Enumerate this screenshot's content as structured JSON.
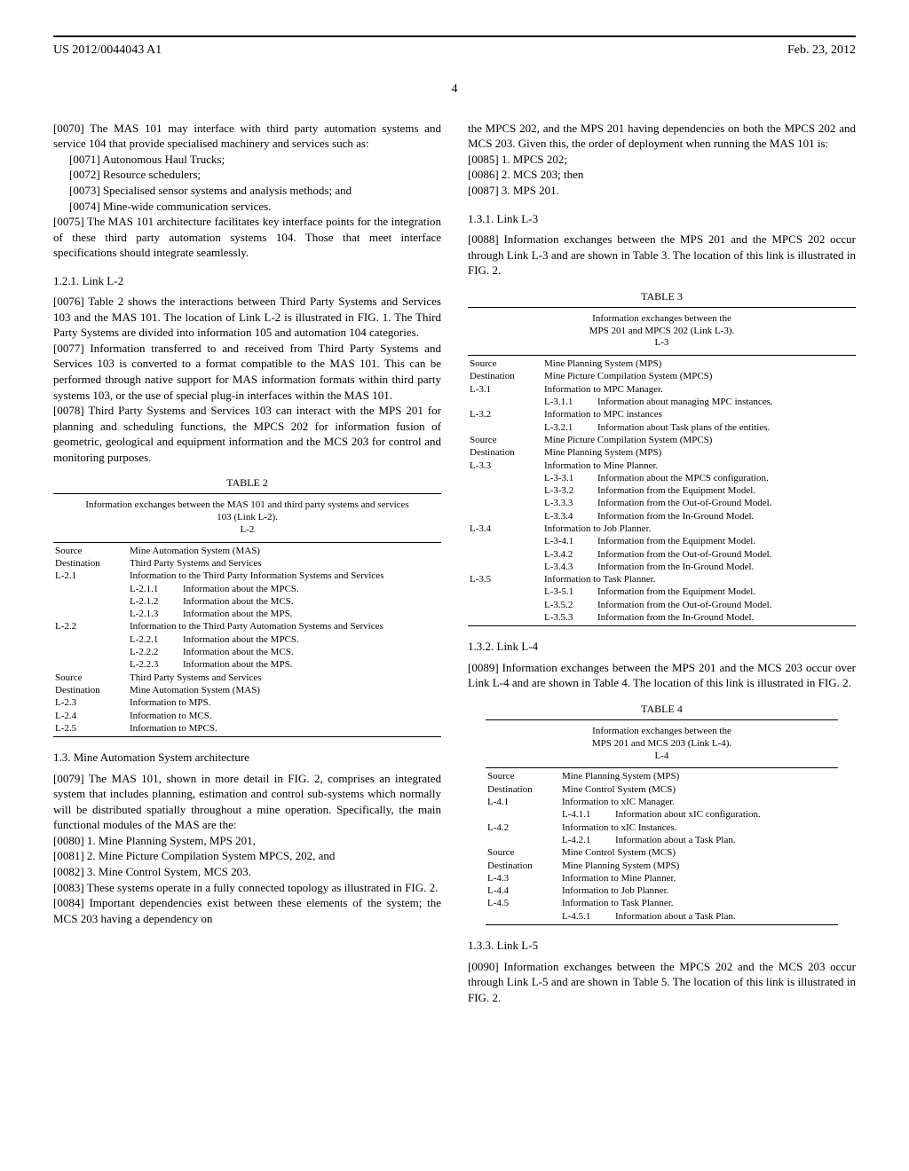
{
  "header": {
    "left": "US 2012/0044043 A1",
    "right": "Feb. 23, 2012",
    "page": "4"
  },
  "col1": {
    "p70": "[0070]   The MAS 101 may interface with third party automation systems and service 104 that provide specialised machinery and services such as:",
    "p71": "[0071]   Autonomous Haul Trucks;",
    "p72": "[0072]   Resource schedulers;",
    "p73": "[0073]   Specialised sensor systems and analysis methods; and",
    "p74": "[0074]   Mine-wide communication services.",
    "p75": "[0075]   The MAS 101 architecture facilitates key interface points for the integration of these third party automation systems 104. Those that meet interface specifications should integrate seamlessly.",
    "h121": "1.2.1. Link L-2",
    "p76": "[0076]   Table 2 shows the interactions between Third Party Systems and Services 103 and the MAS 101. The location of Link L-2 is illustrated in FIG. 1. The Third Party Systems are divided into information 105 and automation 104 categories.",
    "p77": "[0077]   Information transferred to and received from Third Party Systems and Services 103 is converted to a format compatible to the MAS 101. This can be performed through native support for MAS information formats within third party systems 103, or the use of special plug-in interfaces within the MAS 101.",
    "p78": "[0078]   Third Party Systems and Services 103 can interact with the MPS 201 for planning and scheduling functions, the MPCS 202 for information fusion of geometric, geological and equipment information and the MCS 203 for control and monitoring purposes.",
    "table2": {
      "label": "TABLE 2",
      "caption": "Information exchanges between the MAS 101 and third party systems and services 103 (Link L-2).\nL-2",
      "rows": [
        {
          "k": "Source",
          "v": "Mine Automation System (MAS)"
        },
        {
          "k": "Destination",
          "v": "Third Party Systems and Services"
        },
        {
          "k": "L-2.1",
          "v": "Information to the Third Party Information Systems and Services"
        },
        {
          "sub": "L-2.1.1",
          "v": "Information about the MPCS."
        },
        {
          "sub": "L-2.1.2",
          "v": "Information about the MCS."
        },
        {
          "sub": "L-2.1.3",
          "v": "Information about the MPS."
        },
        {
          "k": "L-2.2",
          "v": "Information to the Third Party Automation Systems and Services"
        },
        {
          "sub": "L-2.2.1",
          "v": "Information about the MPCS."
        },
        {
          "sub": "L-2.2.2",
          "v": "Information about the MCS."
        },
        {
          "sub": "L-2.2.3",
          "v": "Information about the MPS."
        },
        {
          "k": "Source",
          "v": "Third Party Systems and Services"
        },
        {
          "k": "Destination",
          "v": "Mine Automation System (MAS)"
        },
        {
          "k": "L-2.3",
          "v": "Information to MPS."
        },
        {
          "k": "L-2.4",
          "v": "Information to MCS."
        },
        {
          "k": "L-2.5",
          "v": "Information to MPCS."
        }
      ]
    },
    "h13": "1.3. Mine Automation System architecture",
    "p79": "[0079]   The MAS 101, shown in more detail in FIG. 2, comprises an integrated system that includes planning, estimation and control sub-systems which normally will be distributed spatially throughout a mine operation. Specifically, the main functional modules of the MAS are the:",
    "p80": "[0080]   1. Mine Planning System, MPS 201,",
    "p81": "[0081]   2. Mine Picture Compilation System MPCS, 202, and",
    "p82": "[0082]   3. Mine Control System, MCS 203.",
    "p83": "[0083]   These systems operate in a fully connected topology as illustrated in FIG. 2.",
    "p84": "[0084]   Important dependencies exist between these elements of the system; the MCS 203 having a dependency on"
  },
  "col2": {
    "cont": "the MPCS 202, and the MPS 201 having dependencies on both the MPCS 202 and MCS 203. Given this, the order of deployment when running the MAS 101 is:",
    "p85": "[0085]   1. MPCS 202;",
    "p86": "[0086]   2. MCS 203; then",
    "p87": "[0087]   3. MPS 201.",
    "h131": "1.3.1. Link L-3",
    "p88": "[0088]   Information exchanges between the MPS 201 and the MPCS 202 occur through Link L-3 and are shown in Table 3. The location of this link is illustrated in FIG. 2.",
    "table3": {
      "label": "TABLE 3",
      "caption": "Information exchanges between the\nMPS 201 and MPCS 202 (Link L-3).\nL-3",
      "rows": [
        {
          "k": "Source",
          "v": "Mine Planning System (MPS)"
        },
        {
          "k": "Destination",
          "v": "Mine Picture Compilation System (MPCS)"
        },
        {
          "k": "L-3.1",
          "v": "Information to MPC Manager."
        },
        {
          "sub": "L-3.1.1",
          "v": "Information about managing MPC instances."
        },
        {
          "k": "L-3.2",
          "v": "Information to MPC instances"
        },
        {
          "sub": "L-3.2.1",
          "v": "Information about Task plans of the entities."
        },
        {
          "k": "Source",
          "v": "Mine Picture Compilation System (MPCS)"
        },
        {
          "k": "Destination",
          "v": "Mine Planning System (MPS)"
        },
        {
          "k": "L-3.3",
          "v": "Information to Mine Planner."
        },
        {
          "sub": "L-3-3.1",
          "v": "Information about the MPCS configuration."
        },
        {
          "sub": "L-3-3.2",
          "v": "Information from the Equipment Model."
        },
        {
          "sub": "L-3.3.3",
          "v": "Information from the Out-of-Ground Model."
        },
        {
          "sub": "L-3.3.4",
          "v": "Information from the In-Ground Model."
        },
        {
          "k": "L-3.4",
          "v": "Information to Job Planner."
        },
        {
          "sub": "L-3-4.1",
          "v": "Information from the Equipment Model."
        },
        {
          "sub": "L-3.4.2",
          "v": "Information from the Out-of-Ground Model."
        },
        {
          "sub": "L-3.4.3",
          "v": "Information from the In-Ground Model."
        },
        {
          "k": "L-3.5",
          "v": "Information to Task Planner."
        },
        {
          "sub": "L-3-5.1",
          "v": "Information from the Equipment Model."
        },
        {
          "sub": "L-3.5.2",
          "v": "Information from the Out-of-Ground Model."
        },
        {
          "sub": "L-3.5.3",
          "v": "Information from the In-Ground Model."
        }
      ]
    },
    "h132": "1.3.2. Link L-4",
    "p89": "[0089]   Information exchanges between the MPS 201 and the MCS 203 occur over Link L-4 and are shown in Table 4. The location of this link is illustrated in FIG. 2.",
    "table4": {
      "label": "TABLE 4",
      "caption": "Information exchanges between the\nMPS 201 and MCS 203 (Link L-4).\nL-4",
      "rows": [
        {
          "k": "Source",
          "v": "Mine Planning System (MPS)"
        },
        {
          "k": "Destination",
          "v": "Mine Control System (MCS)"
        },
        {
          "k": "L-4.1",
          "v": "Information to xIC Manager."
        },
        {
          "sub": "L-4.1.1",
          "v": "Information about xIC configuration."
        },
        {
          "k": "L-4.2",
          "v": "Information to xIC Instances."
        },
        {
          "sub": "L-4.2.1",
          "v": "Information about a Task Plan."
        },
        {
          "k": "Source",
          "v": "Mine Control System (MCS)"
        },
        {
          "k": "Destination",
          "v": "Mine Planning System (MPS)"
        },
        {
          "k": "L-4.3",
          "v": "Information to Mine Planner."
        },
        {
          "k": "L-4.4",
          "v": "Information to Job Planner."
        },
        {
          "k": "L-4.5",
          "v": "Information to Task Planner."
        },
        {
          "sub": "L-4.5.1",
          "v": "Information about a Task Plan."
        }
      ]
    },
    "h133": "1.3.3. Link L-5",
    "p90": "[0090]   Information exchanges between the MPCS 202 and the MCS 203 occur through Link L-5 and are shown in Table 5. The location of this link is illustrated in FIG. 2."
  }
}
